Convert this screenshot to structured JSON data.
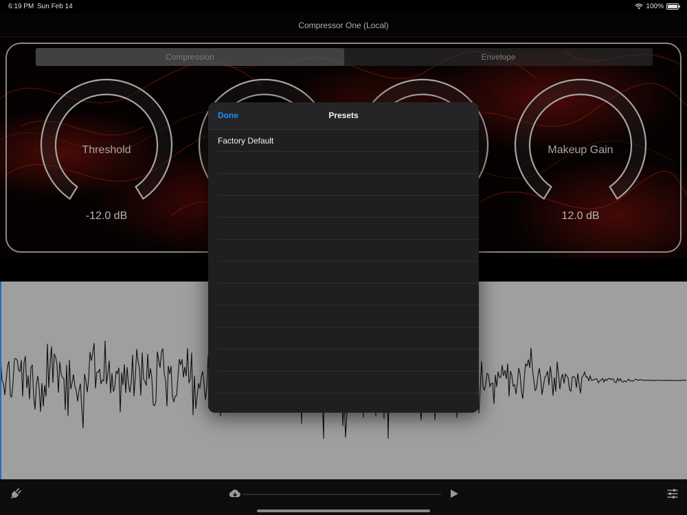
{
  "status_bar": {
    "time": "6:19 PM",
    "date": "Sun Feb 14",
    "battery_text": "100%",
    "battery_level": 1.0
  },
  "nav": {
    "title": "Compressor One (Local)"
  },
  "tabs": [
    {
      "label": "Compression",
      "selected": true
    },
    {
      "label": "Envelope",
      "selected": false
    }
  ],
  "knobs": [
    {
      "label": "Threshold",
      "value": "-12.0 dB"
    },
    {
      "label": "",
      "value": ""
    },
    {
      "label": "",
      "value": ""
    },
    {
      "label": "Makeup Gain",
      "value": "12.0 dB"
    }
  ],
  "presets": {
    "done_label": "Done",
    "title": "Presets",
    "items": [
      "Factory Default",
      "",
      "",
      "",
      "",
      "",
      "",
      "",
      "",
      "",
      "",
      "",
      ""
    ]
  },
  "toolbar": {
    "icons": [
      "plug-icon",
      "cloud-download-icon",
      "play-icon",
      "sliders-icon"
    ]
  },
  "colors": {
    "accent": "#1e8ff5",
    "playhead": "#2f7bd8",
    "waveform_bg": "#b5b5b5",
    "popover_bg": "#1f1f21"
  }
}
